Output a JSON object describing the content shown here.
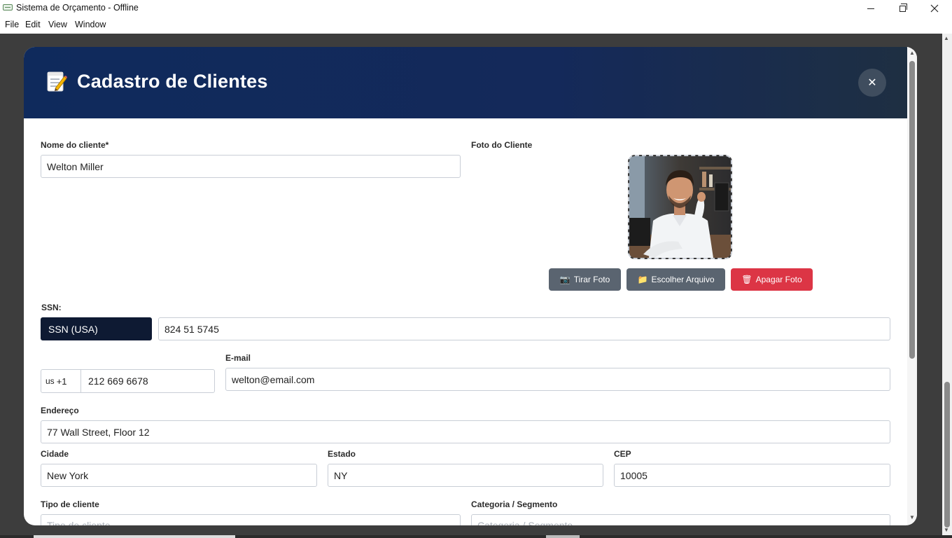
{
  "window": {
    "title": "Sistema de Orçamento - Offline"
  },
  "menu": {
    "items": [
      "File",
      "Edit",
      "View",
      "Window"
    ]
  },
  "modal": {
    "title": "Cadastro de Clientes",
    "header_icon": "memo-icon",
    "close_label": "✕",
    "colors": {
      "header_start": "#0f2a5c",
      "header_end": "#1e2f42",
      "danger": "#dc3545",
      "secondary": "#5a6470",
      "select_dark": "#0e1a33"
    }
  },
  "form": {
    "name": {
      "label": "Nome do cliente*",
      "value": "Welton Miller"
    },
    "photo": {
      "label": "Foto do Cliente",
      "buttons": {
        "take": "Tirar Foto",
        "choose": "Escolher Arquivo",
        "delete": "Apagar Foto"
      }
    },
    "ssn": {
      "label": "SSN:",
      "type_selected": "SSN (USA)",
      "value": "824 51 5745"
    },
    "phone": {
      "country_code": "us",
      "dial_code": "+1",
      "value": "212 669 6678"
    },
    "email": {
      "label": "E-mail",
      "value": "welton@email.com"
    },
    "address": {
      "label": "Endereço",
      "value": "77 Wall Street, Floor 12"
    },
    "city": {
      "label": "Cidade",
      "value": "New York"
    },
    "state": {
      "label": "Estado",
      "value": "NY"
    },
    "zip": {
      "label": "CEP",
      "value": "10005"
    },
    "client_type": {
      "label": "Tipo de cliente",
      "placeholder": "Tipo de cliente"
    },
    "category": {
      "label": "Categoria / Segmento",
      "placeholder": "Categoria / Segmento"
    }
  }
}
